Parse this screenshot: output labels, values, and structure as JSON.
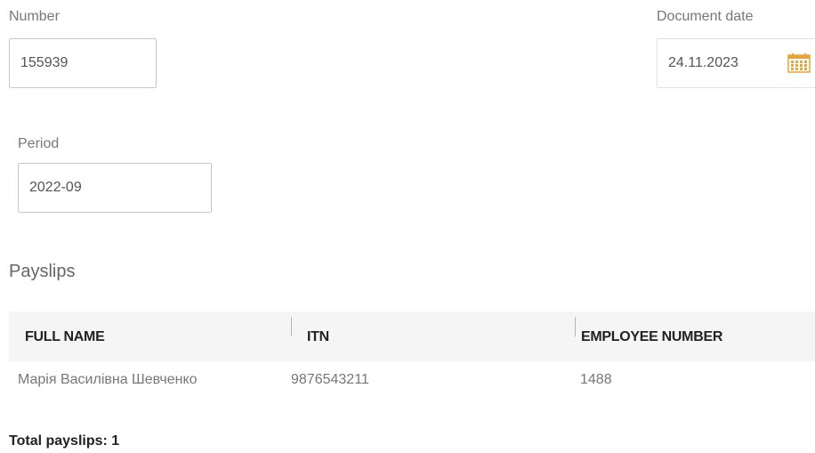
{
  "form": {
    "number": {
      "label": "Number",
      "value": "155939"
    },
    "document_date": {
      "label": "Document date",
      "value": "24.11.2023",
      "icon": "calendar-icon",
      "icon_color": "#e8a33a"
    },
    "period": {
      "label": "Period",
      "value": "2022-09"
    }
  },
  "payslips": {
    "title": "Payslips",
    "columns": [
      "FULL NAME",
      "ITN",
      "EMPLOYEE NUMBER"
    ],
    "rows": [
      {
        "full_name": "Марія Василівна Шевченко",
        "itn": "9876543211",
        "employee_number": "1488"
      }
    ],
    "total_label": "Total payslips: 1"
  }
}
